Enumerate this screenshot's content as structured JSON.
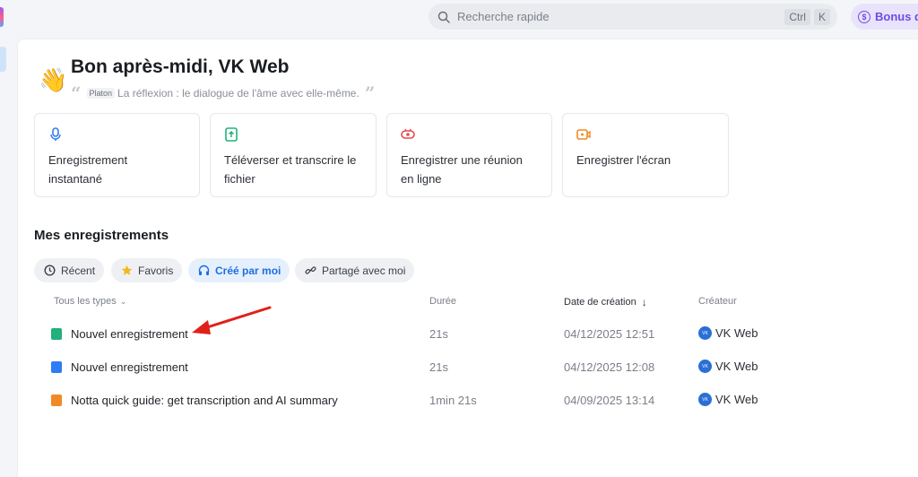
{
  "search": {
    "placeholder": "Recherche rapide",
    "kbd_ctrl": "Ctrl",
    "kbd_k": "K"
  },
  "bonus": {
    "label": "Bonus d"
  },
  "greeting": {
    "title": "Bon après-midi, VK Web",
    "quote_author": "Platon",
    "quote": "La réflexion : le dialogue de l'âme avec elle-même."
  },
  "actions": [
    {
      "label_line1": "Enregistrement",
      "label_line2": "instantané",
      "icon": "mic-icon",
      "color": "#2e7cf6"
    },
    {
      "label_line1": "Téléverser et transcrire le",
      "label_line2": "fichier",
      "icon": "upload-icon",
      "color": "#22b07d"
    },
    {
      "label_line1": "Enregistrer une réunion",
      "label_line2": "en ligne",
      "icon": "meeting-icon",
      "color": "#e5484d"
    },
    {
      "label_line1": "Enregistrer l'écran",
      "label_line2": "",
      "icon": "screen-record-icon",
      "color": "#f08a24"
    }
  ],
  "recordings": {
    "title": "Mes enregistrements",
    "filters": [
      {
        "label": "Récent",
        "icon": "clock-icon"
      },
      {
        "label": "Favoris",
        "icon": "star-icon"
      },
      {
        "label": "Créé par moi",
        "icon": "headphones-icon",
        "active": true
      },
      {
        "label": "Partagé avec moi",
        "icon": "link-icon"
      }
    ],
    "columns": {
      "type": "Tous les types",
      "duration": "Durée",
      "created": "Date de création",
      "creator": "Créateur"
    },
    "rows": [
      {
        "name": "Nouvel enregistrement",
        "duration": "21s",
        "date": "04/12/2025 12:51",
        "creator": "VK Web",
        "type_color": "#22b07d"
      },
      {
        "name": "Nouvel enregistrement",
        "duration": "21s",
        "date": "04/12/2025 12:08",
        "creator": "VK Web",
        "type_color": "#2e7cf6"
      },
      {
        "name": "Notta quick guide: get transcription and AI summary",
        "duration": "1min 21s",
        "date": "04/09/2025 13:14",
        "creator": "VK Web",
        "type_color": "#f08a24"
      }
    ]
  },
  "colors": {
    "accent": "#1e6fe0",
    "annotation_arrow": "#e0201a"
  }
}
